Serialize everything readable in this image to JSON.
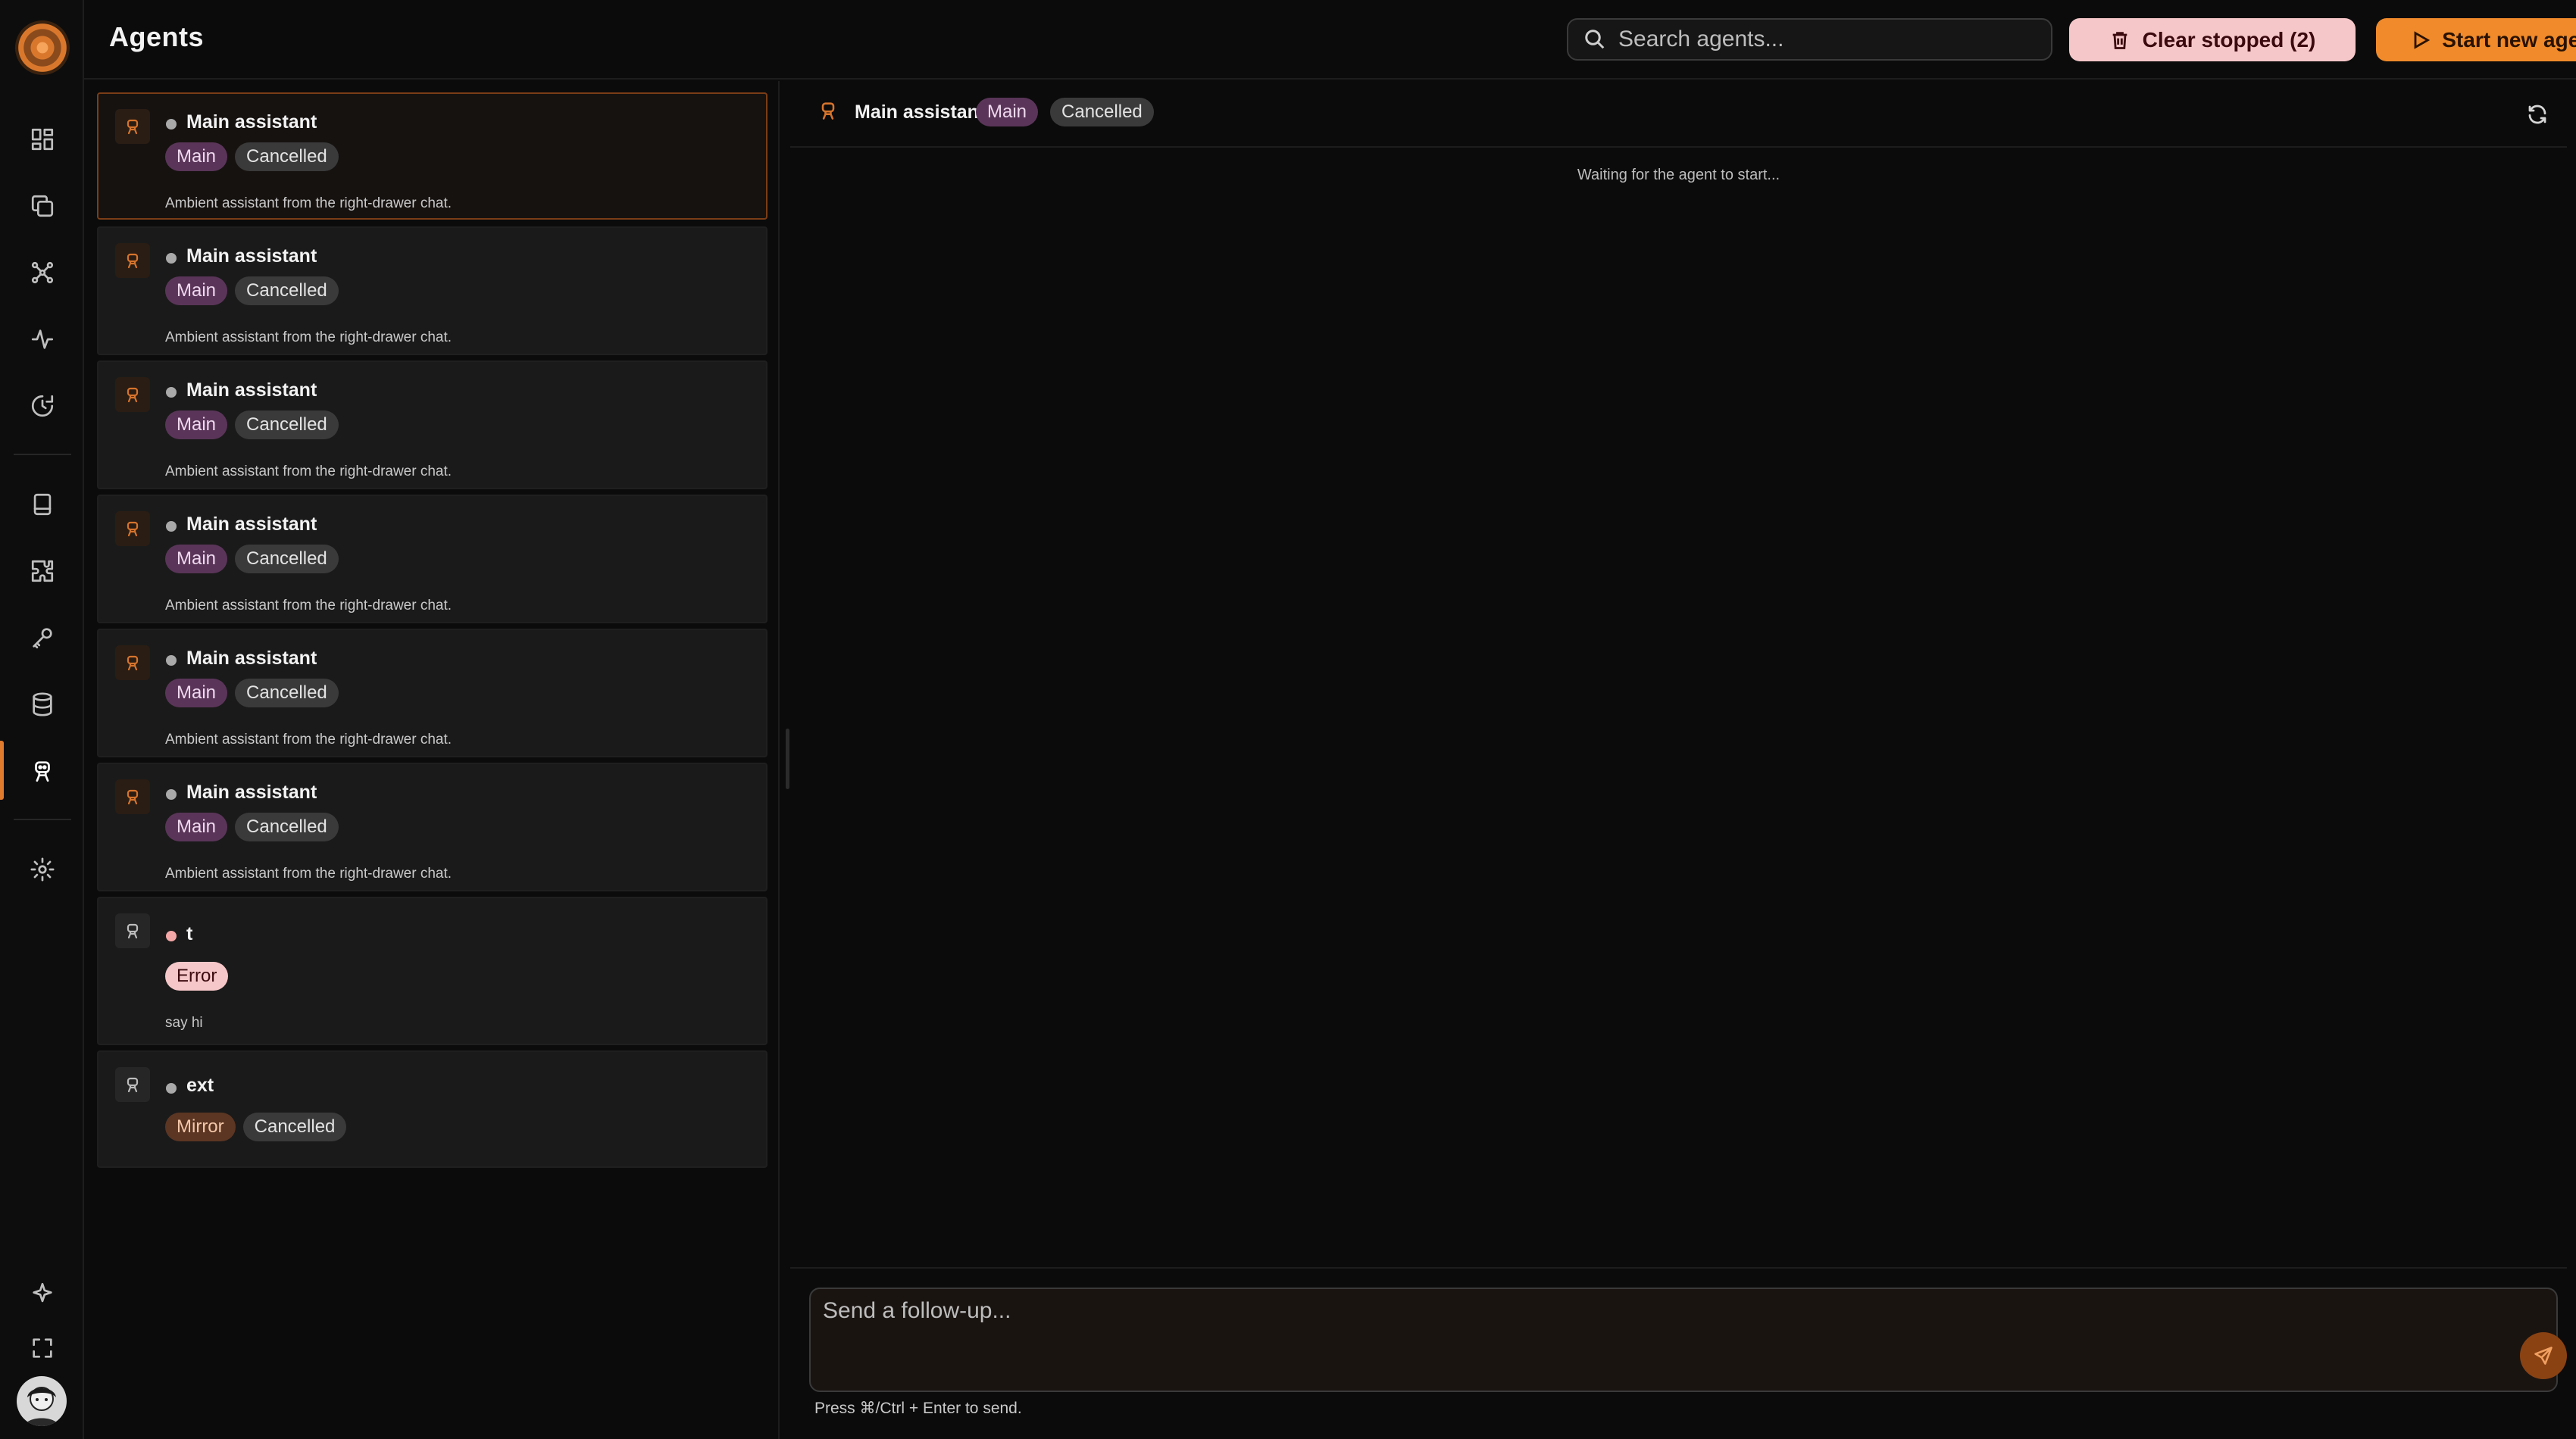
{
  "header": {
    "title": "Agents",
    "search_placeholder": "Search agents...",
    "clear_label": "Clear stopped (2)",
    "start_label": "Start new agent"
  },
  "rail": {
    "icons": [
      "dashboard-icon",
      "copy-icon",
      "network-icon",
      "activity-icon",
      "history-icon",
      "book-icon",
      "puzzle-icon",
      "key-icon",
      "database-icon",
      "agent-icon",
      "settings-icon",
      "sparkle-icon",
      "fullscreen-icon"
    ],
    "active": "agent-icon"
  },
  "agents": [
    {
      "name": "Main assistant",
      "tags": [
        "Main",
        "Cancelled"
      ],
      "desc": "Ambient assistant from the right-drawer chat."
    },
    {
      "name": "Main assistant",
      "tags": [
        "Main",
        "Cancelled"
      ],
      "desc": "Ambient assistant from the right-drawer chat."
    },
    {
      "name": "Main assistant",
      "tags": [
        "Main",
        "Cancelled"
      ],
      "desc": "Ambient assistant from the right-drawer chat."
    },
    {
      "name": "Main assistant",
      "tags": [
        "Main",
        "Cancelled"
      ],
      "desc": "Ambient assistant from the right-drawer chat."
    },
    {
      "name": "Main assistant",
      "tags": [
        "Main",
        "Cancelled"
      ],
      "desc": "Ambient assistant from the right-drawer chat."
    },
    {
      "name": "Main assistant",
      "tags": [
        "Main",
        "Cancelled"
      ],
      "desc": "Ambient assistant from the right-drawer chat."
    },
    {
      "name": "t",
      "tags": [
        "Error"
      ],
      "desc": "say hi"
    },
    {
      "name": "ext",
      "tags": [
        "Mirror",
        "Cancelled"
      ],
      "desc": ""
    }
  ],
  "detail": {
    "name": "Main assistant",
    "tags": [
      "Main",
      "Cancelled"
    ],
    "waiting": "Waiting for the agent to start...",
    "composer_placeholder": "Send a follow-up...",
    "hint": "Press ⌘/Ctrl + Enter to send."
  },
  "colors": {
    "accent": "#f08a2a",
    "danger_bg": "#f6c7c9",
    "main_tag": "#5a3559",
    "cancel_tag": "#3a3a3a"
  }
}
